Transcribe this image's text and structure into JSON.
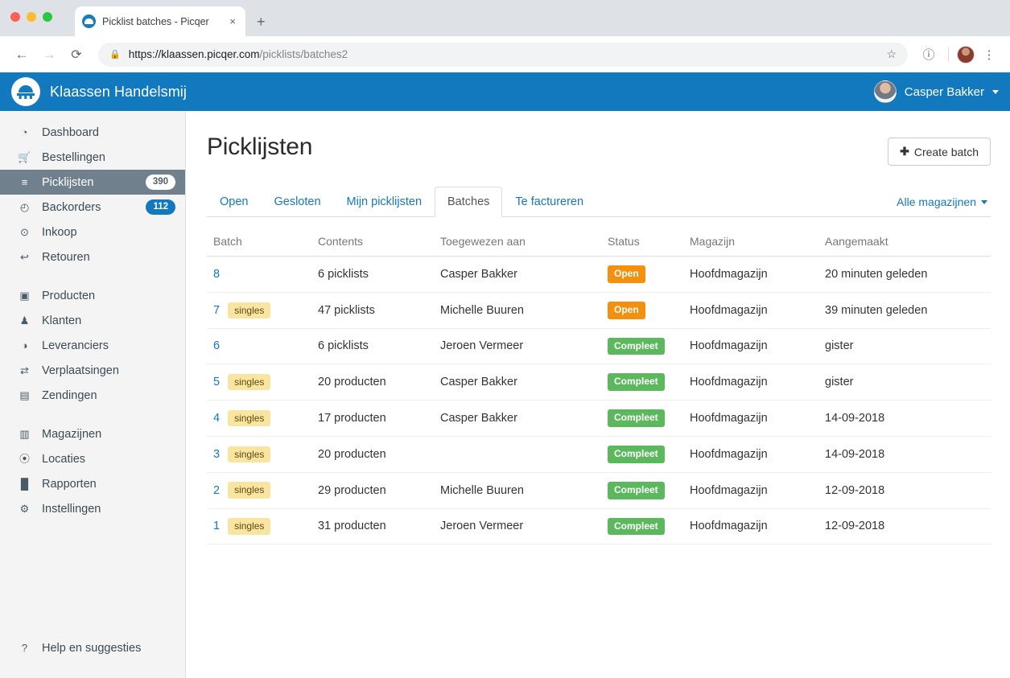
{
  "browser": {
    "tab_title": "Picklist batches - Picqer",
    "tab_close": "×",
    "new_tab": "+",
    "back_icon": "←",
    "forward_icon": "→",
    "reload_icon": "⟳",
    "lock_icon": "ὑ2",
    "url_secure": "https://klaassen.picqer.com",
    "url_path": "/picklists/batches2",
    "star_icon": "☆",
    "info_icon": "ⓘ",
    "menu_icon": "⋮"
  },
  "appbar": {
    "brand": "Klaassen Handelsmij",
    "user_name": "Casper Bakker"
  },
  "sidebar": {
    "groups": [
      {
        "items": [
          {
            "label": "Dashboard",
            "icon": "dashboard-icon",
            "glyph": "◔",
            "badge": null,
            "active": false
          },
          {
            "label": "Bestellingen",
            "icon": "cart-icon",
            "glyph": "🛒",
            "badge": null,
            "active": false
          },
          {
            "label": "Picklijsten",
            "icon": "list-icon",
            "glyph": "≡",
            "badge": "390",
            "badge_style": "white",
            "active": true
          },
          {
            "label": "Backorders",
            "icon": "clock-icon",
            "glyph": "◴",
            "badge": "112",
            "badge_style": "blue",
            "active": false
          },
          {
            "label": "Inkoop",
            "icon": "download-circle-icon",
            "glyph": "⊙",
            "badge": null,
            "active": false
          },
          {
            "label": "Retouren",
            "icon": "reply-arrow-icon",
            "glyph": "↩",
            "badge": null,
            "active": false
          }
        ]
      },
      {
        "items": [
          {
            "label": "Producten",
            "icon": "image-icon",
            "glyph": "▣",
            "badge": null,
            "active": false
          },
          {
            "label": "Klanten",
            "icon": "users-icon",
            "glyph": "♟",
            "badge": null,
            "active": false
          },
          {
            "label": "Leveranciers",
            "icon": "globe-icon",
            "glyph": "◑",
            "badge": null,
            "active": false
          },
          {
            "label": "Verplaatsingen",
            "icon": "transfer-icon",
            "glyph": "⇄",
            "badge": null,
            "active": false
          },
          {
            "label": "Zendingen",
            "icon": "truck-icon",
            "glyph": "▤",
            "badge": null,
            "active": false
          }
        ]
      },
      {
        "items": [
          {
            "label": "Magazijnen",
            "icon": "building-icon",
            "glyph": "▥",
            "badge": null,
            "active": false
          },
          {
            "label": "Locaties",
            "icon": "map-pin-icon",
            "glyph": "⦿",
            "badge": null,
            "active": false
          },
          {
            "label": "Rapporten",
            "icon": "bar-chart-icon",
            "glyph": "█",
            "badge": null,
            "active": false
          },
          {
            "label": "Instellingen",
            "icon": "gear-icon",
            "glyph": "⚙",
            "badge": null,
            "active": false
          }
        ]
      }
    ],
    "footer": {
      "label": "Help en suggesties",
      "icon": "question-circle-icon",
      "glyph": "?"
    }
  },
  "main": {
    "page_title": "Picklijsten",
    "create_button": {
      "plus": "✚",
      "label": "Create batch"
    },
    "tabs": [
      {
        "label": "Open",
        "active": false
      },
      {
        "label": "Gesloten",
        "active": false
      },
      {
        "label": "Mijn picklijsten",
        "active": false
      },
      {
        "label": "Batches",
        "active": true
      },
      {
        "label": "Te factureren",
        "active": false
      }
    ],
    "warehouse_filter": "Alle magazijnen",
    "table": {
      "columns": [
        "Batch",
        "Contents",
        "Toegewezen aan",
        "Status",
        "Magazijn",
        "Aangemaakt"
      ],
      "rows": [
        {
          "batch": "8",
          "tag": null,
          "contents": "6 picklists",
          "assigned": "Casper Bakker",
          "status": "Open",
          "status_style": "open",
          "warehouse": "Hoofdmagazijn",
          "created": "20 minuten geleden"
        },
        {
          "batch": "7",
          "tag": "singles",
          "contents": "47 picklists",
          "assigned": "Michelle Buuren",
          "status": "Open",
          "status_style": "open",
          "warehouse": "Hoofdmagazijn",
          "created": "39 minuten geleden"
        },
        {
          "batch": "6",
          "tag": null,
          "contents": "6 picklists",
          "assigned": "Jeroen Vermeer",
          "status": "Compleet",
          "status_style": "compleet",
          "warehouse": "Hoofdmagazijn",
          "created": "gister"
        },
        {
          "batch": "5",
          "tag": "singles",
          "contents": "20 producten",
          "assigned": "Casper Bakker",
          "status": "Compleet",
          "status_style": "compleet",
          "warehouse": "Hoofdmagazijn",
          "created": "gister"
        },
        {
          "batch": "4",
          "tag": "singles",
          "contents": "17 producten",
          "assigned": "Casper Bakker",
          "status": "Compleet",
          "status_style": "compleet",
          "warehouse": "Hoofdmagazijn",
          "created": "14-09-2018"
        },
        {
          "batch": "3",
          "tag": "singles",
          "contents": "20 producten",
          "assigned": "",
          "status": "Compleet",
          "status_style": "compleet",
          "warehouse": "Hoofdmagazijn",
          "created": "14-09-2018"
        },
        {
          "batch": "2",
          "tag": "singles",
          "contents": "29 producten",
          "assigned": "Michelle Buuren",
          "status": "Compleet",
          "status_style": "compleet",
          "warehouse": "Hoofdmagazijn",
          "created": "12-09-2018"
        },
        {
          "batch": "1",
          "tag": "singles",
          "contents": "31 producten",
          "assigned": "Jeroen Vermeer",
          "status": "Compleet",
          "status_style": "compleet",
          "warehouse": "Hoofdmagazijn",
          "created": "12-09-2018"
        }
      ]
    }
  },
  "colors": {
    "brand_blue": "#1279bf",
    "sidebar_bg": "#f4f4f4",
    "sidebar_active": "#70818d",
    "status_open": "#f3900f",
    "status_compleet": "#5cb85c",
    "tag_singles": "#fae5a0"
  }
}
